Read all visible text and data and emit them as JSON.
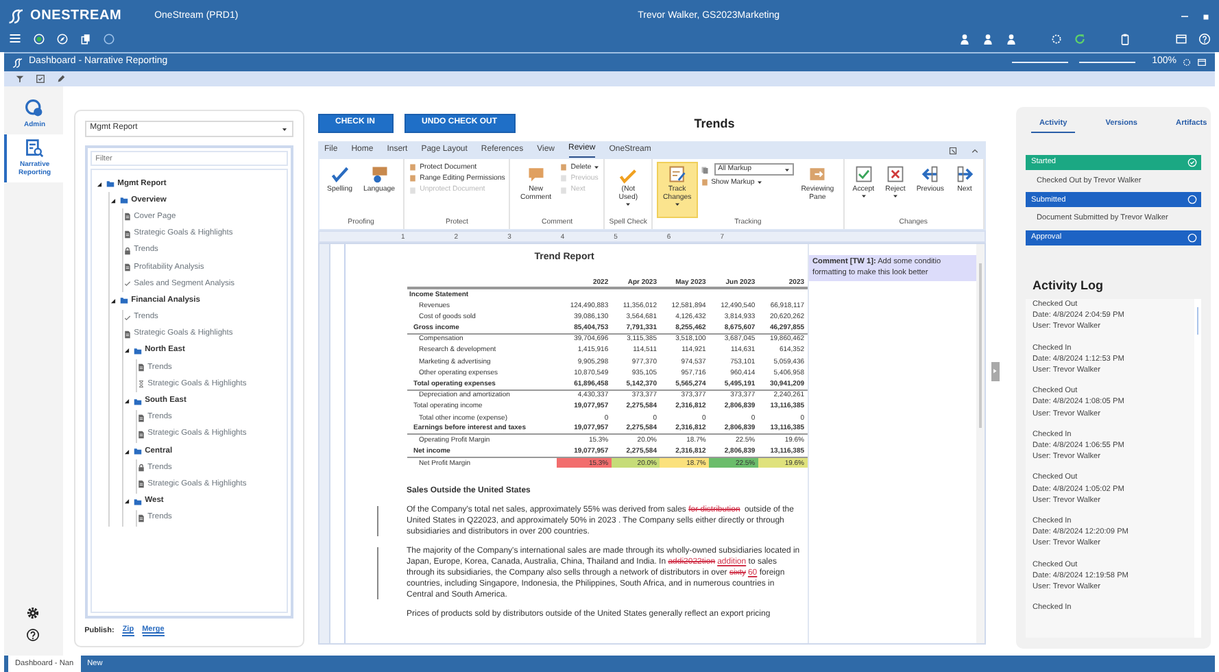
{
  "top_bar": {
    "logo": "ONESTREAM",
    "app": "OneStream (PRD1)",
    "user": "Trevor Walker, GS2023Marketing"
  },
  "dashboard_bar": {
    "title": "Dashboard - Narrative Reporting",
    "zoom": {
      "level": 0.5,
      "reading": "100%"
    }
  },
  "left_nav": [
    {
      "label": "Admin",
      "selected": false
    },
    {
      "label": "Narrative Reporting",
      "selected": true
    }
  ],
  "tree_panel": {
    "report": "Mgmt Report",
    "filter_placeholder": "Filter",
    "tree": [
      {
        "label": "Mgmt Report",
        "kind": "folder",
        "expanded": true,
        "children": [
          {
            "label": "Overview",
            "kind": "folder",
            "expanded": true,
            "children": [
              {
                "label": "Cover Page",
                "kind": "draft"
              },
              {
                "label": "Strategic Goals & Highlights",
                "kind": "draft"
              },
              {
                "label": "Trends",
                "kind": "locked"
              },
              {
                "label": "Profitability Analysis",
                "kind": "draft"
              },
              {
                "label": "Sales and Segment Analysis",
                "kind": "approved"
              }
            ]
          },
          {
            "label": "Financial Analysis",
            "kind": "folder",
            "expanded": true,
            "children": [
              {
                "label": "Trends",
                "kind": "approved"
              },
              {
                "label": "Strategic Goals & Highlights",
                "kind": "draft"
              },
              {
                "label": "North East",
                "kind": "folder",
                "expanded": true,
                "children": [
                  {
                    "label": "Trends",
                    "kind": "draft"
                  },
                  {
                    "label": "Strategic Goals & Highlights",
                    "kind": "pending"
                  }
                ]
              },
              {
                "label": "South East",
                "kind": "folder",
                "expanded": true,
                "children": [
                  {
                    "label": "Trends",
                    "kind": "draft"
                  },
                  {
                    "label": "Strategic Goals & Highlights",
                    "kind": "draft"
                  }
                ]
              },
              {
                "label": "Central",
                "kind": "folder",
                "expanded": true,
                "children": [
                  {
                    "label": "Trends",
                    "kind": "locked"
                  },
                  {
                    "label": "Strategic Goals & Highlights",
                    "kind": "draft"
                  }
                ]
              },
              {
                "label": "West",
                "kind": "folder",
                "expanded": true,
                "children": [
                  {
                    "label": "Trends",
                    "kind": "draft"
                  }
                ]
              }
            ]
          }
        ]
      }
    ],
    "publish_label": "Publish:",
    "publish_links": [
      "Zip",
      "Merge"
    ]
  },
  "document": {
    "buttons": [
      "CHECK IN",
      "UNDO CHECK OUT"
    ],
    "title": "Trends",
    "ribbon": {
      "tabs": [
        {
          "label": "File",
          "selected": false
        },
        {
          "label": "Home",
          "selected": false
        },
        {
          "label": "Insert",
          "selected": false
        },
        {
          "label": "Page Layout",
          "selected": false
        },
        {
          "label": "References",
          "selected": false
        },
        {
          "label": "View",
          "selected": false
        },
        {
          "label": "Review",
          "selected": true
        },
        {
          "label": "OneStream",
          "selected": false
        }
      ],
      "groups": [
        {
          "label": "Proofing",
          "items": [
            {
              "label": "Spelling",
              "kind": "large"
            },
            {
              "label": "Language",
              "kind": "large"
            }
          ]
        },
        {
          "label": "Protect",
          "items": [
            {
              "label": "Protect Document",
              "kind": "small",
              "disabled": false
            },
            {
              "label": "Range Editing Permissions",
              "kind": "small",
              "disabled": false
            },
            {
              "label": "Unprotect Document",
              "kind": "small",
              "disabled": true
            }
          ]
        },
        {
          "label": "Comment",
          "items": [
            {
              "label": "New Comment",
              "kind": "large"
            },
            {
              "label": "Delete",
              "kind": "small",
              "dropdown": true,
              "disabled": false
            },
            {
              "label": "Previous",
              "kind": "small",
              "disabled": true
            },
            {
              "label": "Next",
              "kind": "small",
              "disabled": true
            }
          ]
        },
        {
          "label": "Spell Check",
          "items": [
            {
              "label": "(Not Used)",
              "kind": "large",
              "dropdown": true
            }
          ]
        },
        {
          "label": "Tracking",
          "items": [
            {
              "label": "Track Changes",
              "kind": "large",
              "dropdown": true,
              "selected": true
            },
            {
              "value": "All Markup",
              "kind": "select"
            },
            {
              "label": "Show Markup",
              "kind": "small",
              "dropdown": true
            },
            {
              "label": "Reviewing Pane",
              "kind": "large",
              "selected": false
            }
          ]
        },
        {
          "label": "Changes",
          "items": [
            {
              "label": "Accept",
              "kind": "large",
              "dropdown": true
            },
            {
              "label": "Reject",
              "kind": "large",
              "dropdown": true
            },
            {
              "label": "Previous",
              "kind": "large"
            },
            {
              "label": "Next",
              "kind": "large"
            }
          ]
        }
      ]
    },
    "ruler_numbers": [
      "1",
      "2",
      "3",
      "4",
      "5",
      "6",
      "7"
    ],
    "report_title": "Trend Report",
    "comment": "**Comment [TW 1]:** Add some conditio formatting to make this look better",
    "table": {
      "columns": [
        "2022",
        "Apr 2023",
        "May 2023",
        "Jun 2023",
        "2023"
      ],
      "rows": [
        {
          "label": "Income Statement",
          "kind": "section",
          "values": []
        },
        {
          "label": "Revenues",
          "kind": "line",
          "values": [
            "124,490,883",
            "11,356,012",
            "12,581,894",
            "12,490,540",
            "66,918,117"
          ]
        },
        {
          "label": "Cost of goods sold",
          "kind": "line",
          "values": [
            "39,086,130",
            "3,564,681",
            "4,126,432",
            "3,814,933",
            "20,620,262"
          ]
        },
        {
          "label": "Gross income",
          "kind": "total",
          "values": [
            "85,404,753",
            "7,791,331",
            "8,255,462",
            "8,675,607",
            "46,297,855"
          ]
        },
        {
          "label": "Compensation",
          "kind": "line",
          "values": [
            "39,704,696",
            "3,115,385",
            "3,518,100",
            "3,687,045",
            "19,860,462"
          ]
        },
        {
          "label": "Research & development",
          "kind": "line",
          "values": [
            "1,415,916",
            "114,511",
            "114,921",
            "114,631",
            "614,352"
          ]
        },
        {
          "label": "Marketing & advertising",
          "kind": "line",
          "values": [
            "9,905,298",
            "977,370",
            "974,537",
            "753,101",
            "5,059,436"
          ]
        },
        {
          "label": "Other operating expenses",
          "kind": "line",
          "values": [
            "10,870,549",
            "935,105",
            "957,716",
            "960,414",
            "5,406,958"
          ]
        },
        {
          "label": "Total operating expenses",
          "kind": "total",
          "values": [
            "61,896,458",
            "5,142,370",
            "5,565,274",
            "5,495,191",
            "30,941,209"
          ]
        },
        {
          "label": "Depreciation and amortization",
          "kind": "line",
          "values": [
            "4,430,337",
            "373,377",
            "373,377",
            "373,377",
            "2,240,261"
          ]
        },
        {
          "label": "Total operating income",
          "kind": "subtotal",
          "values": [
            "19,077,957",
            "2,275,584",
            "2,316,812",
            "2,806,839",
            "13,116,385"
          ]
        },
        {
          "label": "Total other income (expense)",
          "kind": "line",
          "values": [
            "0",
            "0",
            "0",
            "0",
            "0"
          ]
        },
        {
          "label": "Earnings before interest and taxes",
          "kind": "total",
          "values": [
            "19,077,957",
            "2,275,584",
            "2,316,812",
            "2,806,839",
            "13,116,385"
          ]
        },
        {
          "label": "Operating Profit Margin",
          "kind": "line",
          "values": [
            "15.3%",
            "20.0%",
            "18.7%",
            "22.5%",
            "19.6%"
          ]
        },
        {
          "label": "Net income",
          "kind": "total",
          "values": [
            "19,077,957",
            "2,275,584",
            "2,316,812",
            "2,806,839",
            "13,116,385"
          ]
        },
        {
          "label": "Net Profit Margin",
          "kind": "line",
          "values": [
            {
              "text": "15.3%",
              "color": "#f26d6d"
            },
            {
              "text": "20.0%",
              "color": "#c6dc78"
            },
            {
              "text": "18.7%",
              "color": "#fbe17c"
            },
            {
              "text": "22.5%",
              "color": "#6bbd6b"
            },
            {
              "text": "19.6%",
              "color": "#dfe27c"
            }
          ]
        }
      ]
    },
    "section_heading": "Sales Outside the United States",
    "paragraphs": [
      {
        "changed": true,
        "runs": [
          {
            "kind": "plain",
            "text": "Of the Company's total net sales, approximately 55% was derived from sales "
          },
          {
            "kind": "del",
            "text": "for distribution"
          },
          {
            "kind": "plain",
            "text": " outside of the United States in Q22023, and approximately 50% in 2023 . The Company sells either directly or through subsidiaries and distributors in over 200 countries."
          }
        ]
      },
      {
        "changed": true,
        "runs": [
          {
            "kind": "plain",
            "text": "The majority of the Company's international sales are made through its wholly-owned subsidiaries located in Japan, Europe, Korea, Canada, Australia, China, Thailand and India. In "
          },
          {
            "kind": "del",
            "text": "addi2022tion"
          },
          {
            "kind": "ins",
            "text": "addition"
          },
          {
            "kind": "plain",
            "text": " to sales through its subsidiaries, the Company also sells through a network of distributors in over "
          },
          {
            "kind": "del",
            "text": "sixty"
          },
          {
            "kind": "ins",
            "text": "60"
          },
          {
            "kind": "plain",
            "text": " foreign countries, including Singapore, Indonesia, the Philippines, South Africa, and in numerous countries in Central and South America."
          }
        ]
      },
      {
        "changed": false,
        "runs": [
          {
            "kind": "plain",
            "text": "Prices of products sold by distributors outside of the United States generally reflect an export pricing"
          }
        ]
      }
    ]
  },
  "right_panel": {
    "tabs": [
      {
        "label": "Activity",
        "selected": true
      },
      {
        "label": "Versions",
        "selected": false
      },
      {
        "label": "Artifacts",
        "selected": false
      }
    ],
    "workflow": [
      {
        "label": "Started",
        "complete": true,
        "note": "Checked Out by Trevor Walker"
      },
      {
        "label": "Submitted",
        "complete": false,
        "note": "Document Submitted by Trevor Walker"
      },
      {
        "label": "Approval",
        "complete": false
      }
    ],
    "log_title": "Activity Log",
    "log": [
      {
        "action": "Checked Out",
        "date": "Date: 4/8/2024 2:04:59 PM",
        "user": "User: Trevor Walker"
      },
      {
        "action": "Checked In",
        "date": "Date: 4/8/2024 1:12:53 PM",
        "user": "User: Trevor Walker"
      },
      {
        "action": "Checked Out",
        "date": "Date: 4/8/2024 1:08:05 PM",
        "user": "User: Trevor Walker"
      },
      {
        "action": "Checked In",
        "date": "Date: 4/8/2024 1:06:55 PM",
        "user": "User: Trevor Walker"
      },
      {
        "action": "Checked Out",
        "date": "Date: 4/8/2024 1:05:02 PM",
        "user": "User: Trevor Walker"
      },
      {
        "action": "Checked In",
        "date": "Date: 4/8/2024 12:20:09 PM",
        "user": "User: Trevor Walker"
      },
      {
        "action": "Checked Out",
        "date": "Date: 4/8/2024 12:19:58 PM",
        "user": "User: Trevor Walker"
      },
      {
        "action": "Checked In"
      }
    ]
  },
  "bottom_tabs": [
    {
      "label": "Dashboard - Nan",
      "selected": true
    },
    {
      "label": "New",
      "selected": false
    }
  ]
}
